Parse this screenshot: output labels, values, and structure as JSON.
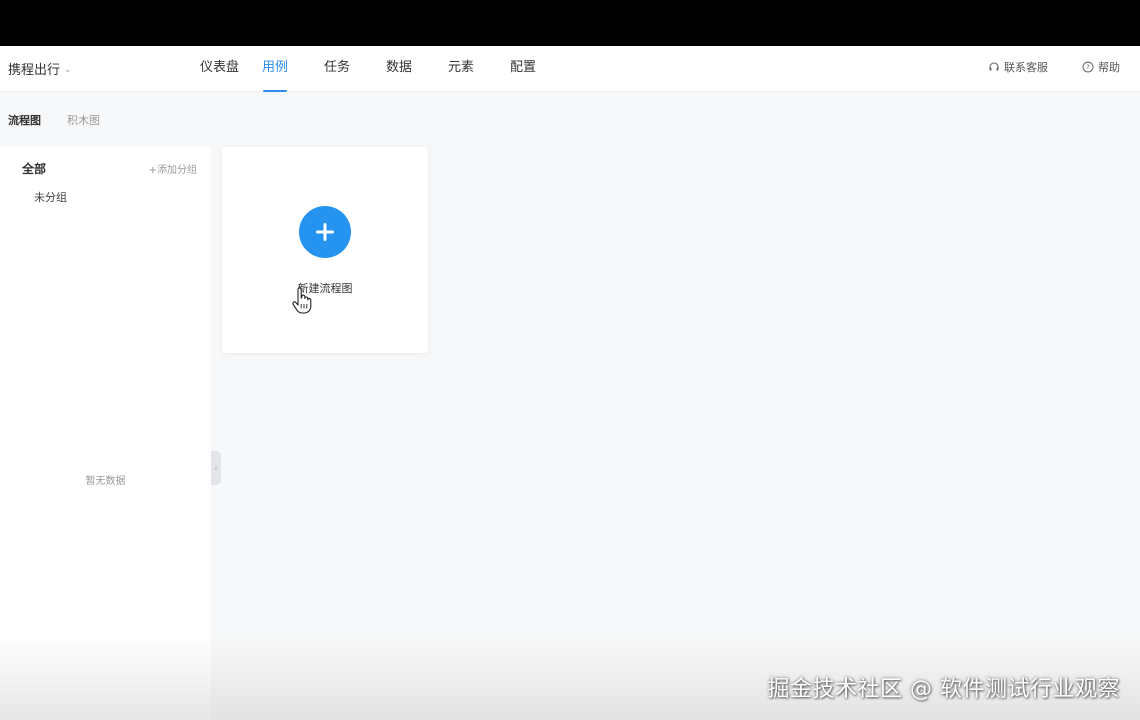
{
  "header": {
    "project": "携程出行",
    "nav": [
      {
        "label": "仪表盘",
        "active": false
      },
      {
        "label": "用例",
        "active": true
      },
      {
        "label": "任务",
        "active": false
      },
      {
        "label": "数据",
        "active": false
      },
      {
        "label": "元素",
        "active": false
      },
      {
        "label": "配置",
        "active": false
      }
    ],
    "support": "联系客服",
    "help": "帮助"
  },
  "subtabs": [
    "流程图",
    "积木图"
  ],
  "sidebar": {
    "all": "全部",
    "add_group": "+添加分组",
    "ungrouped": "未分组",
    "empty": "暂无数据"
  },
  "card": {
    "label": "新建流程图"
  },
  "watermark": "掘金技术社区 @ 软件测试行业观察",
  "colors": {
    "accent": "#2f8cf0",
    "plus_button": "#2593f0"
  },
  "icons": {
    "support": "headset-icon",
    "help": "question-circle-icon",
    "plus": "plus-icon",
    "cursor": "hand-pointer-icon"
  }
}
